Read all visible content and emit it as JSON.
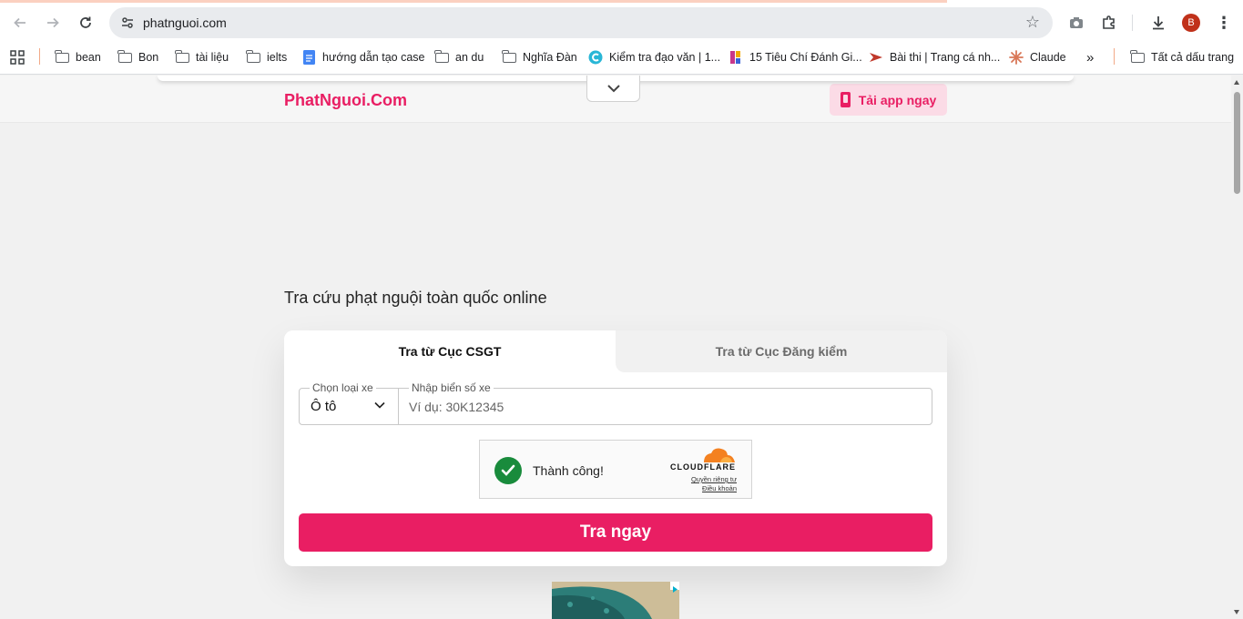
{
  "browser": {
    "url": "phatnguoi.com",
    "avatar_letter": "B",
    "bookmarks": [
      {
        "label": "bean",
        "icon": "folder-icon"
      },
      {
        "label": "Bon",
        "icon": "folder-icon"
      },
      {
        "label": "tài liệu",
        "icon": "folder-icon"
      },
      {
        "label": "ielts",
        "icon": "folder-icon"
      },
      {
        "label": "hướng dẫn tạo case",
        "icon": "google-docs-icon"
      },
      {
        "label": "an du",
        "icon": "folder-icon"
      },
      {
        "label": "Nghĩa Đàn",
        "icon": "folder-icon"
      },
      {
        "label": "Kiểm tra đạo văn | 1...",
        "icon": "plagiarism-site-icon"
      },
      {
        "label": "15 Tiêu Chí Đánh Gi...",
        "icon": "site-favicon"
      },
      {
        "label": "Bài thi | Trang cá nh...",
        "icon": "site-favicon"
      },
      {
        "label": "Claude",
        "icon": "claude-icon"
      }
    ],
    "all_bookmarks_label": "Tất cả dấu trang"
  },
  "header": {
    "logo": "PhatNguoi.Com",
    "app_button_label": "Tải app ngay"
  },
  "main": {
    "heading": "Tra cứu phạt nguội toàn quốc online",
    "tabs": [
      {
        "label": "Tra từ Cục CSGT",
        "active": true
      },
      {
        "label": "Tra từ Cục Đăng kiểm",
        "active": false
      }
    ],
    "vehicle_select": {
      "label": "Chọn loại xe",
      "value": "Ô tô"
    },
    "plate_input": {
      "label": "Nhập biển số xe",
      "placeholder": "Ví dụ: 30K12345",
      "value": ""
    },
    "captcha": {
      "status": "Thành công!",
      "brand": "CLOUDFLARE",
      "privacy_link": "Quyền riêng tư",
      "terms_link": "Điều khoản"
    },
    "submit_label": "Tra ngay"
  },
  "colors": {
    "brand": "#e91e63",
    "brand_light": "#fbdbe6",
    "success": "#198b3c",
    "cloudflare_orange": "#f48120"
  }
}
